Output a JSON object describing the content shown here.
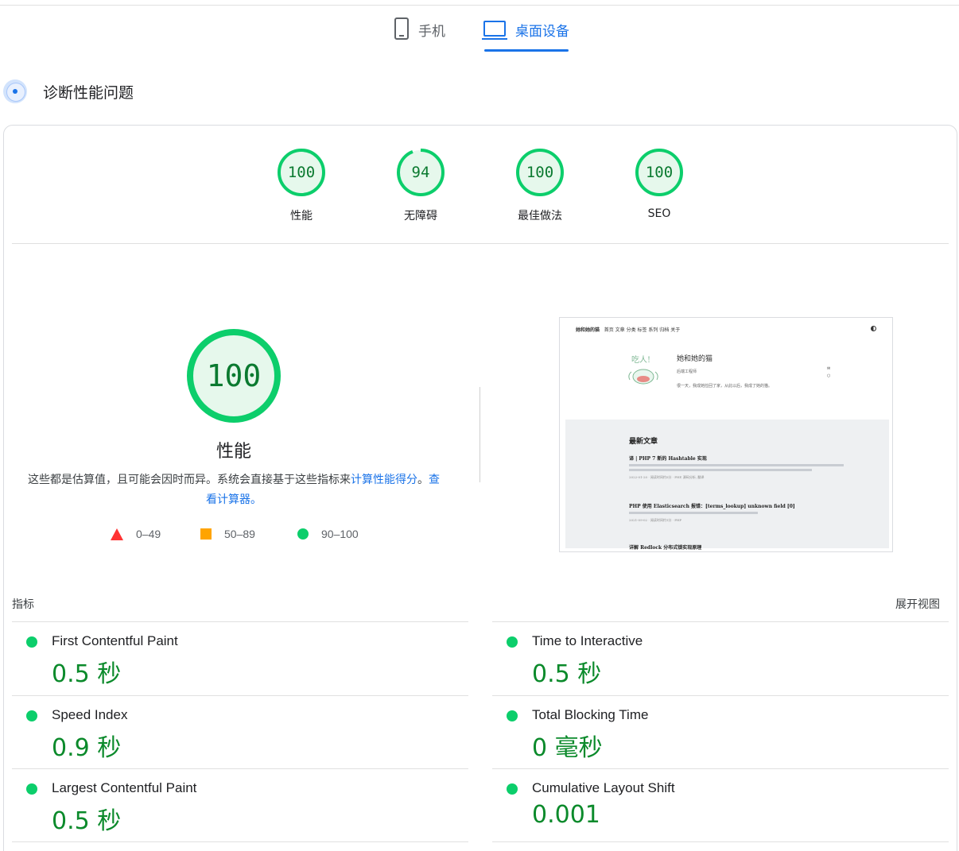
{
  "device_tabs": {
    "mobile": {
      "label": "手机",
      "icon": "phone-icon"
    },
    "desktop": {
      "label": "桌面设备",
      "icon": "laptop-icon",
      "active": true
    }
  },
  "diagnose": {
    "title": "诊断性能问题",
    "icon": "gauge-icon"
  },
  "gauges": [
    {
      "score": "100",
      "label": "性能"
    },
    {
      "score": "94",
      "label": "无障碍"
    },
    {
      "score": "100",
      "label": "最佳做法"
    },
    {
      "score": "100",
      "label": "SEO"
    }
  ],
  "performance": {
    "score": "100",
    "title": "性能",
    "note_prefix": "这些都是估算值，且可能会因时而异。系统会直接基于这些指标来",
    "note_link1": "计算性能得分",
    "note_mid": "。",
    "note_link2": "查看计算器。",
    "legend": [
      {
        "shape": "triangle",
        "color": "#ff3333",
        "range": "0–49"
      },
      {
        "shape": "square",
        "color": "#ffa400",
        "range": "50–89"
      },
      {
        "shape": "circle",
        "color": "#0cce6b",
        "range": "90–100"
      }
    ]
  },
  "thumbnail": {
    "site_name": "她和她的猫",
    "nav_items": "首页  文章  分类  标签  系列  归档  关于",
    "profile_name": "她和她的猫",
    "profile_sub": "后端工程师",
    "profile_desc": "很一天，我成她捡回了家，从此以后，我成了她的猫。",
    "mascot_text": "吃人!",
    "posts_heading": "最新文章",
    "posts": [
      {
        "title": "译 | PHP 7 新的 Hashtable 实现",
        "meta": "2022-01-20  ·  阅读时间约5分  ·  PHP, 源码分析, 翻译"
      },
      {
        "title": "PHP 使用 Elasticsearch 报错：[terms_lookup] unknown field [0]",
        "meta": "2021-09-02  ·  阅读时间约1分  ·  PHP"
      },
      {
        "title": "详解 Redlock 分布式锁实现原理",
        "meta": ""
      }
    ]
  },
  "metrics": {
    "label": "指标",
    "expand": "展开视图",
    "left": [
      {
        "name": "First Contentful Paint",
        "value": "0.5 秒"
      },
      {
        "name": "Speed Index",
        "value": "0.9 秒"
      },
      {
        "name": "Largest Contentful Paint",
        "value": "0.5 秒"
      }
    ],
    "right": [
      {
        "name": "Time to Interactive",
        "value": "0.5 秒"
      },
      {
        "name": "Total Blocking Time",
        "value": "0 毫秒"
      },
      {
        "name": "Cumulative Layout Shift",
        "value": "0.001"
      }
    ]
  },
  "colors": {
    "accent": "#1a73e8",
    "pass": "#0cce6b",
    "pass_text": "#0b8a2b"
  }
}
